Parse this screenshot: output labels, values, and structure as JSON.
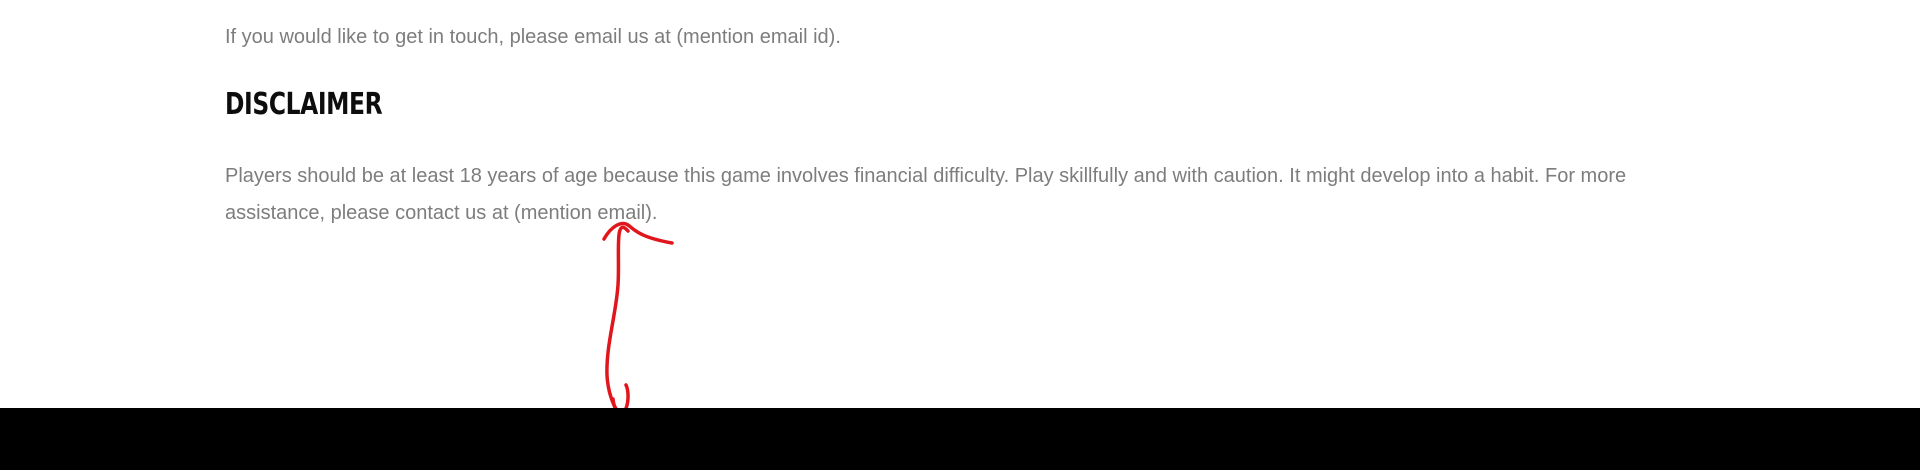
{
  "contact": {
    "text": "If you would like to get in touch, please email us at (mention email id)."
  },
  "disclaimer": {
    "heading": "DISCLAIMER",
    "body": "Players should be at least 18 years of age because this game involves financial difficulty. Play skillfully and with caution. It might develop into a habit. For more assistance, please contact us at (mention email)."
  },
  "annotation": {
    "color": "#e0161c",
    "shape": "double-headed-arrow"
  },
  "footer": {
    "color": "#000000"
  }
}
